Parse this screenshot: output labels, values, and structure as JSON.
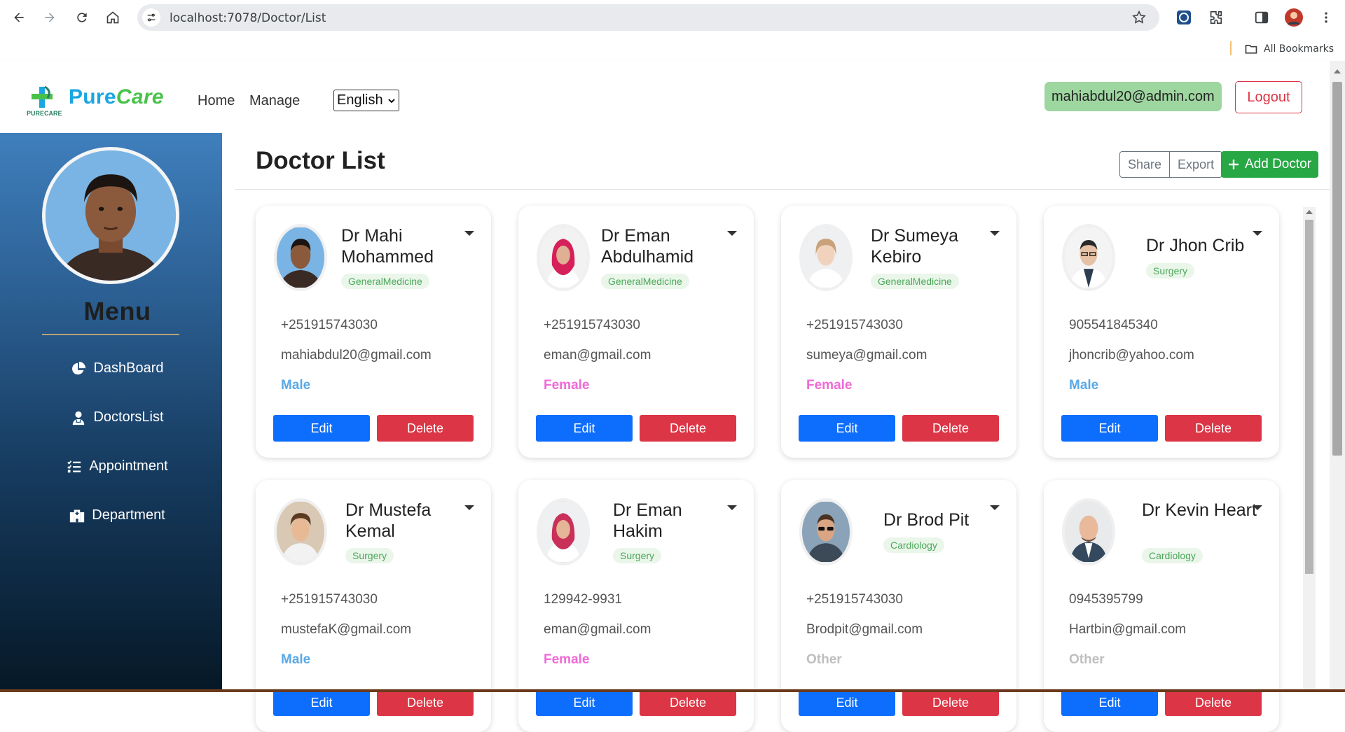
{
  "browser": {
    "url": "localhost:7078/Doctor/List",
    "bookmarks_label": "All Bookmarks"
  },
  "header": {
    "logo_pure": "Pure",
    "logo_care": "Care",
    "logo_small": "PURECARE",
    "nav": [
      "Home",
      "Manage"
    ],
    "language": "English",
    "user_email": "mahiabdul20@admin.com",
    "logout_label": "Logout"
  },
  "sidebar": {
    "menu_title": "Menu",
    "items": [
      {
        "label": "DashBoard",
        "icon": "pie-chart-icon"
      },
      {
        "label": "DoctorsList",
        "icon": "doctor-icon"
      },
      {
        "label": "Appointment",
        "icon": "checklist-icon"
      },
      {
        "label": "Department",
        "icon": "hospital-icon"
      }
    ]
  },
  "main": {
    "title": "Doctor List",
    "share_label": "Share",
    "export_label": "Export",
    "add_label": "Add Doctor",
    "edit_label": "Edit",
    "delete_label": "Delete"
  },
  "doctors": [
    {
      "name": "Dr Mahi Mohammed",
      "department": "GeneralMedicine",
      "phone": "+251915743030",
      "email": "mahiabdul20@gmail.com",
      "gender": "Male"
    },
    {
      "name": "Dr Eman Abdulhamid",
      "department": "GeneralMedicine",
      "phone": "+251915743030",
      "email": "eman@gmail.com",
      "gender": "Female"
    },
    {
      "name": "Dr Sumeya Kebiro",
      "department": "GeneralMedicine",
      "phone": "+251915743030",
      "email": "sumeya@gmail.com",
      "gender": "Female"
    },
    {
      "name": "Dr Jhon Crib",
      "department": "Surgery",
      "phone": "905541845340",
      "email": "jhoncrib@yahoo.com",
      "gender": "Male"
    },
    {
      "name": "Dr Mustefa Kemal",
      "department": "Surgery",
      "phone": "+251915743030",
      "email": "mustefaK@gmail.com",
      "gender": "Male"
    },
    {
      "name": "Dr Eman Hakim",
      "department": "Surgery",
      "phone": "129942-9931",
      "email": "eman@gmail.com",
      "gender": "Female"
    },
    {
      "name": "Dr Brod Pit",
      "department": "Cardiology",
      "phone": "+251915743030",
      "email": "Brodpit@gmail.com",
      "gender": "Other"
    },
    {
      "name": "Dr Kevin Heart",
      "department": "Cardiology",
      "phone": "0945395799",
      "email": "Hartbin@gmail.com",
      "gender": "Other"
    }
  ],
  "colors": {
    "primary": "#0d6efd",
    "danger": "#dc3545",
    "success": "#28a745",
    "male": "#5aa9e6",
    "female": "#f06ad7",
    "other": "#bfbfbf"
  }
}
